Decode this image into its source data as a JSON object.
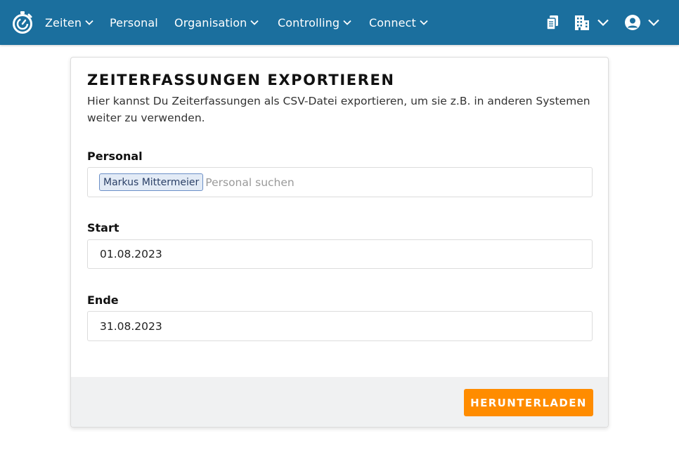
{
  "nav": {
    "items": [
      {
        "label": "Zeiten",
        "has_dropdown": true
      },
      {
        "label": "Personal",
        "has_dropdown": false
      },
      {
        "label": "Organisation",
        "has_dropdown": true
      },
      {
        "label": "Controlling",
        "has_dropdown": true
      },
      {
        "label": "Connect",
        "has_dropdown": true
      }
    ],
    "icons": [
      "stopwatch-logo-icon",
      "documents-icon",
      "building-icon",
      "user-account-icon"
    ],
    "bar_color": "#1b6f9e"
  },
  "export": {
    "title": "ZEITERFASSUNGEN EXPORTIEREN",
    "description": "Hier kannst Du Zeiterfassungen als CSV-Datei exportieren, um sie z.B. in anderen Systemen weiter zu verwenden.",
    "personal": {
      "label": "Personal",
      "selected_tag": "Markus Mittermeier",
      "placeholder": "Personal suchen"
    },
    "start": {
      "label": "Start",
      "value": "01.08.2023"
    },
    "end": {
      "label": "Ende",
      "value": "31.08.2023"
    },
    "download_label": "HERUNTERLADEN",
    "button_color": "#ff8c00"
  }
}
